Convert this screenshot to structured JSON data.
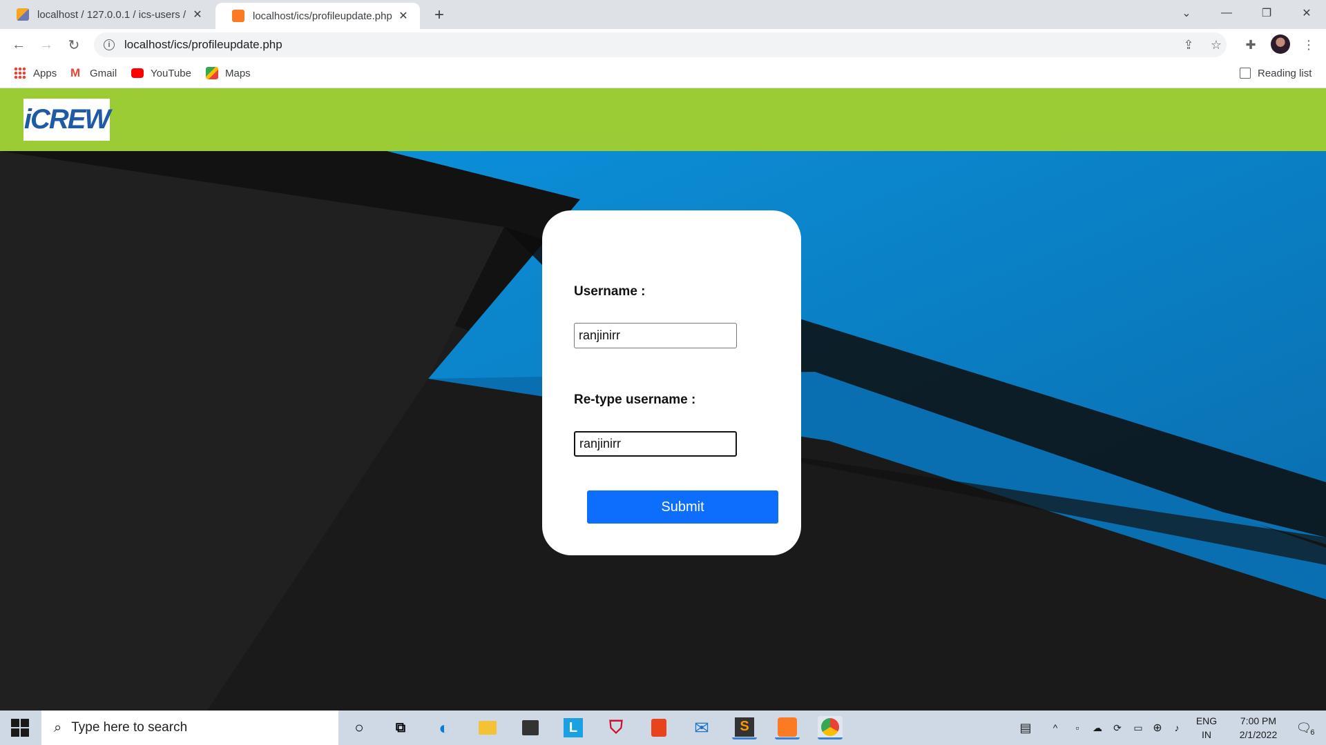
{
  "browser": {
    "tabs": [
      {
        "label": "localhost / 127.0.0.1 / ics-users /",
        "active": false,
        "icon": "phpmyadmin-icon"
      },
      {
        "label": "localhost/ics/profileupdate.php",
        "active": true,
        "icon": "xampp-icon"
      }
    ],
    "url": "localhost/ics/profileupdate.php",
    "bookmarks": [
      "Apps",
      "Gmail",
      "YouTube",
      "Maps"
    ],
    "reading_list": "Reading list"
  },
  "page": {
    "logo_text": "iCREW",
    "form": {
      "username_label": "Username :",
      "username_value": "ranjinirr",
      "retype_label": "Re-type username :",
      "retype_value": "ranjinirr",
      "submit_label": "Submit"
    },
    "colors": {
      "header": "#9ccc34",
      "submit": "#0d6efd",
      "accent_blue": "#0a84d4"
    }
  },
  "taskbar": {
    "search_placeholder": "Type here to search",
    "language": "ENG",
    "region": "IN",
    "time": "7:00 PM",
    "date": "2/1/2022",
    "notifications": "6"
  }
}
